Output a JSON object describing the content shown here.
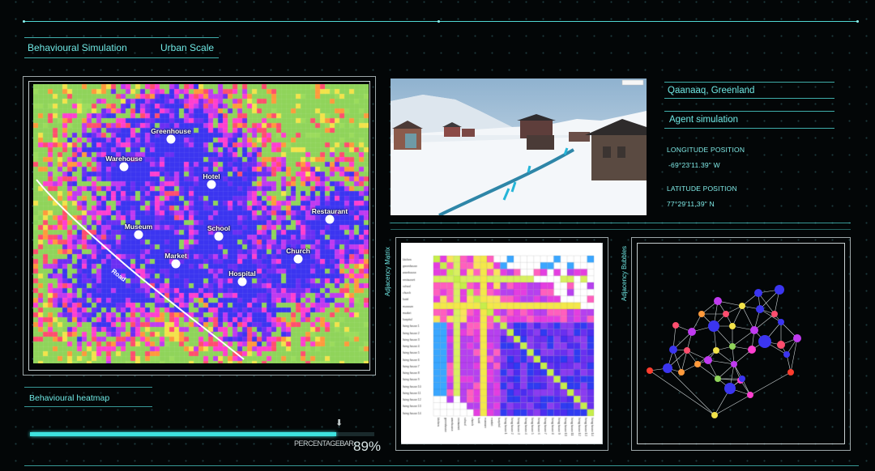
{
  "header": {
    "title": "Behavioural Simulation",
    "scale": "Urban Scale"
  },
  "heatmap": {
    "caption": "Behavioural heatmap",
    "locations": [
      {
        "name": "Greenhouse"
      },
      {
        "name": "Warehouse"
      },
      {
        "name": "Hotel"
      },
      {
        "name": "Museum"
      },
      {
        "name": "School"
      },
      {
        "name": "Restaurant"
      },
      {
        "name": "Church"
      },
      {
        "name": "Market"
      },
      {
        "name": "Hospital"
      }
    ],
    "road_label": "Road",
    "palette": [
      "#8fd45a",
      "#9bdc5c",
      "#f3e34a",
      "#ff9a3c",
      "#ff4e6e",
      "#ff3fd0",
      "#c03af0",
      "#6b2ff3",
      "#3b35f0"
    ]
  },
  "info": {
    "location": "Qaanaaq, Greenland",
    "mode": "Agent simulation",
    "longitude_label": "LONGITUDE POSITION",
    "longitude_value": "-69°23'11.39\" W",
    "latitude_label": "LATITUDE POSITION",
    "latitude_value": "77°29'11,39\" N"
  },
  "matrix": {
    "title": "Adjacency Matrix",
    "labels": [
      "kitchen",
      "greenhouse",
      "warehouse",
      "restaurant",
      "school",
      "church",
      "hotel",
      "museum",
      "market",
      "hospital",
      "living house 1",
      "living house 2",
      "living house 3",
      "living house 4",
      "living house 5",
      "living house 6",
      "living house 7",
      "living house 8",
      "living house 9",
      "living house 10",
      "living house 11",
      "living house 12",
      "living house 13",
      "living house 14"
    ]
  },
  "bubbles": {
    "title": "Adjacency Bubbles"
  },
  "progress": {
    "label": "PERCENTAGEBAR",
    "value_text": "89%",
    "value": 0.89
  }
}
